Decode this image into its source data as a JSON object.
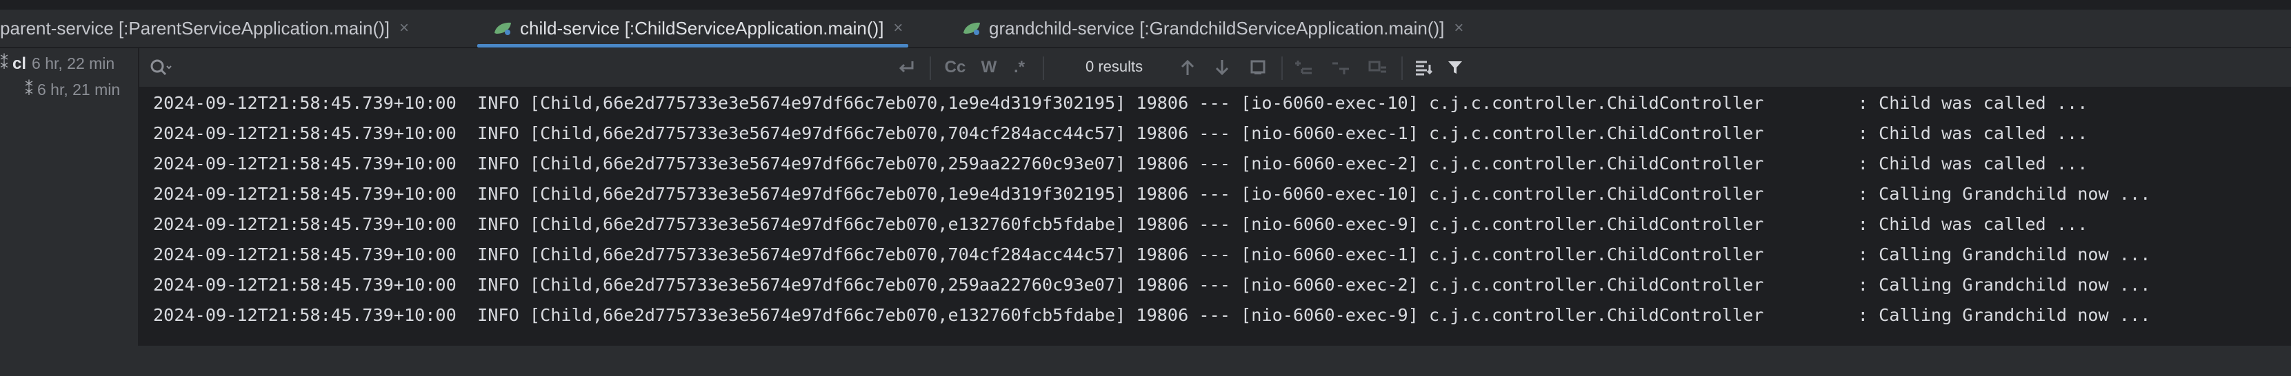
{
  "tabs": [
    {
      "label": "parent-service [:ParentServiceApplication.main()]",
      "active": false,
      "icon": "spring-run-icon"
    },
    {
      "label": "child-service [:ChildServiceApplication.main()]",
      "active": true,
      "icon": "spring-run-icon"
    },
    {
      "label": "grandchild-service [:GrandchildServiceApplication.main()]",
      "active": false,
      "icon": "spring-run-icon"
    }
  ],
  "sidebar": {
    "items": [
      {
        "name": "cl",
        "time": "6 hr, 22 min"
      },
      {
        "name": "",
        "time": "6 hr, 21 min"
      }
    ]
  },
  "search": {
    "placeholder": "",
    "value": ""
  },
  "toolbar": {
    "cc_label": "Cc",
    "w_label": "W",
    "results": "0 results"
  },
  "log_lines": [
    "2024-09-12T21:58:45.739+10:00  INFO [Child,66e2d775733e3e5674e97df66c7eb070,1e9e4d319f302195] 19806 --- [io-6060-exec-10] c.j.c.controller.ChildController         : Child was called ...",
    "2024-09-12T21:58:45.739+10:00  INFO [Child,66e2d775733e3e5674e97df66c7eb070,704cf284acc44c57] 19806 --- [nio-6060-exec-1] c.j.c.controller.ChildController         : Child was called ...",
    "2024-09-12T21:58:45.739+10:00  INFO [Child,66e2d775733e3e5674e97df66c7eb070,259aa22760c93e07] 19806 --- [nio-6060-exec-2] c.j.c.controller.ChildController         : Child was called ...",
    "2024-09-12T21:58:45.739+10:00  INFO [Child,66e2d775733e3e5674e97df66c7eb070,1e9e4d319f302195] 19806 --- [io-6060-exec-10] c.j.c.controller.ChildController         : Calling Grandchild now ...",
    "2024-09-12T21:58:45.739+10:00  INFO [Child,66e2d775733e3e5674e97df66c7eb070,e132760fcb5fdabe] 19806 --- [nio-6060-exec-9] c.j.c.controller.ChildController         : Child was called ...",
    "2024-09-12T21:58:45.739+10:00  INFO [Child,66e2d775733e3e5674e97df66c7eb070,704cf284acc44c57] 19806 --- [nio-6060-exec-1] c.j.c.controller.ChildController         : Calling Grandchild now ...",
    "2024-09-12T21:58:45.739+10:00  INFO [Child,66e2d775733e3e5674e97df66c7eb070,259aa22760c93e07] 19806 --- [nio-6060-exec-2] c.j.c.controller.ChildController         : Calling Grandchild now ...",
    "2024-09-12T21:58:45.739+10:00  INFO [Child,66e2d775733e3e5674e97df66c7eb070,e132760fcb5fdabe] 19806 --- [nio-6060-exec-9] c.j.c.controller.ChildController         : Calling Grandchild now ..."
  ],
  "colors": {
    "accent": "#4a88c7",
    "log_bg": "#1e1f22",
    "panel_bg": "#2b2d30",
    "run_icon": "#6aab73"
  }
}
